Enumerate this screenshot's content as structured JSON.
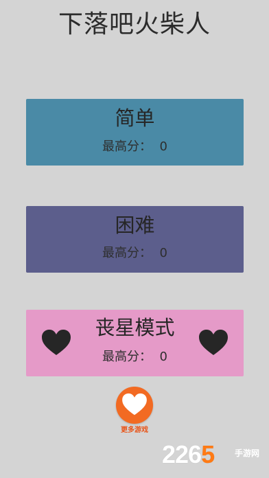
{
  "game_title": "下落吧火柴人",
  "modes": [
    {
      "name": "简单",
      "score_label": "最高分：",
      "score_value": "0",
      "color": "#4a8aa6"
    },
    {
      "name": "困难",
      "score_label": "最高分：",
      "score_value": "0",
      "color": "#5c5e8c"
    },
    {
      "name": "丧星模式",
      "score_label": "最高分：",
      "score_value": "0",
      "color": "#e59ac8",
      "decorations": [
        "heart-icon",
        "heart-icon"
      ]
    }
  ],
  "more_games": {
    "label": "更多游戏",
    "icon": "heart-icon",
    "color": "#f26a22"
  },
  "watermark": {
    "number_prefix": "226",
    "number_suffix": "5",
    "site_name": "手游网"
  }
}
